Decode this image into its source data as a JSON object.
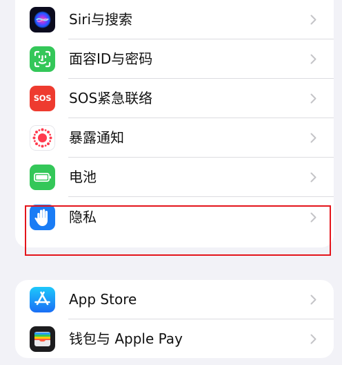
{
  "settings_group_1": {
    "items": [
      {
        "label": "Siri与搜索",
        "icon": "siri-icon"
      },
      {
        "label": "面容ID与密码",
        "icon": "face-id-icon"
      },
      {
        "label": "SOS紧急联络",
        "icon": "sos-icon",
        "icon_text": "SOS"
      },
      {
        "label": "暴露通知",
        "icon": "exposure-notification-icon"
      },
      {
        "label": "电池",
        "icon": "battery-icon"
      },
      {
        "label": "隐私",
        "icon": "privacy-hand-icon"
      }
    ]
  },
  "settings_group_2": {
    "items": [
      {
        "label": "App Store",
        "icon": "app-store-icon"
      },
      {
        "label": "钱包与 Apple Pay",
        "icon": "wallet-icon"
      }
    ]
  },
  "highlighted_item": "隐私",
  "colors": {
    "background": "#f2f2f7",
    "highlight_border": "#e4141b",
    "face_id_green": "#34c759",
    "sos_red": "#ee3b2f",
    "battery_green": "#34c759",
    "privacy_blue": "#1a7cf5",
    "app_store_blue": "#1a8cf5",
    "wallet_black": "#1c1c1e"
  }
}
